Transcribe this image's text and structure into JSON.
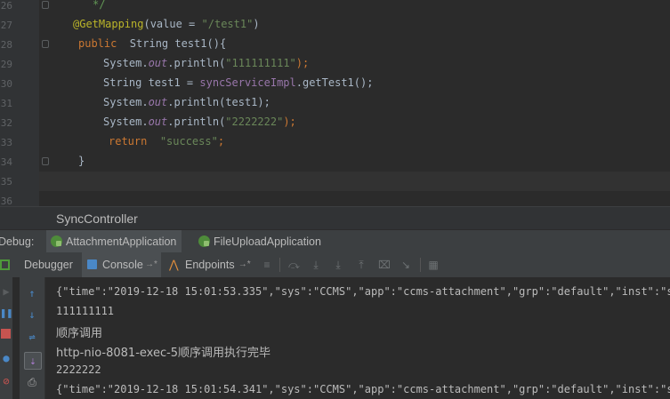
{
  "editor": {
    "line_numbers": [
      "26",
      "27",
      "28",
      "29",
      "30",
      "31",
      "32",
      "33",
      "34",
      "35",
      "36"
    ],
    "comment_end": "*/",
    "annotation": "@GetMapping",
    "annotation_args": "(value = ",
    "annotation_value": "\"/test1\"",
    "annotation_close": ")",
    "method_sig_kw": "public",
    "method_sig_rest": "  String test1(){",
    "line29_a": "System.",
    "line29_out": "out",
    "line29_b": ".println(",
    "line29_str": "\"111111111\"",
    "line29_c": ");",
    "line30_a": "String test1 = ",
    "line30_field": "syncServiceImpl",
    "line30_b": ".getTest1();",
    "line31_a": "System.",
    "line31_out": "out",
    "line31_b": ".println(test1);",
    "line32_a": "System.",
    "line32_out": "out",
    "line32_b": ".println(",
    "line32_str": "\"2222222\"",
    "line32_c": ");",
    "line33_kw": "return",
    "line33_str": "\"success\"",
    "line33_c": ";",
    "close_brace": "}"
  },
  "breadcrumb": {
    "label": "SyncController"
  },
  "debug_bar": {
    "prefix": "Debug:",
    "tabs": [
      "AttachmentApplication",
      "FileUploadApplication"
    ]
  },
  "tool_tabs": {
    "debugger": "Debugger",
    "console": "Console",
    "endpoints": "Endpoints"
  },
  "console": {
    "lines": [
      "{\"time\":\"2019-12-18 15:01:53.335\",\"sys\":\"CCMS\",\"app\":\"ccms-attachment\",\"grp\":\"default\",\"inst\":\"sc:c",
      "111111111",
      "顺序调用",
      "http-nio-8081-exec-5顺序调用执行完毕",
      "2222222",
      "{\"time\":\"2019-12-18 15:01:54.341\",\"sys\":\"CCMS\",\"app\":\"ccms-attachment\",\"grp\":\"default\",\"inst\":\"sc:c"
    ]
  },
  "colors": {
    "keyword": "#cc7832",
    "string": "#6a8759",
    "annotation": "#bbb529",
    "field": "#9876aa",
    "default": "#a9b7c6",
    "comment": "#629755"
  }
}
